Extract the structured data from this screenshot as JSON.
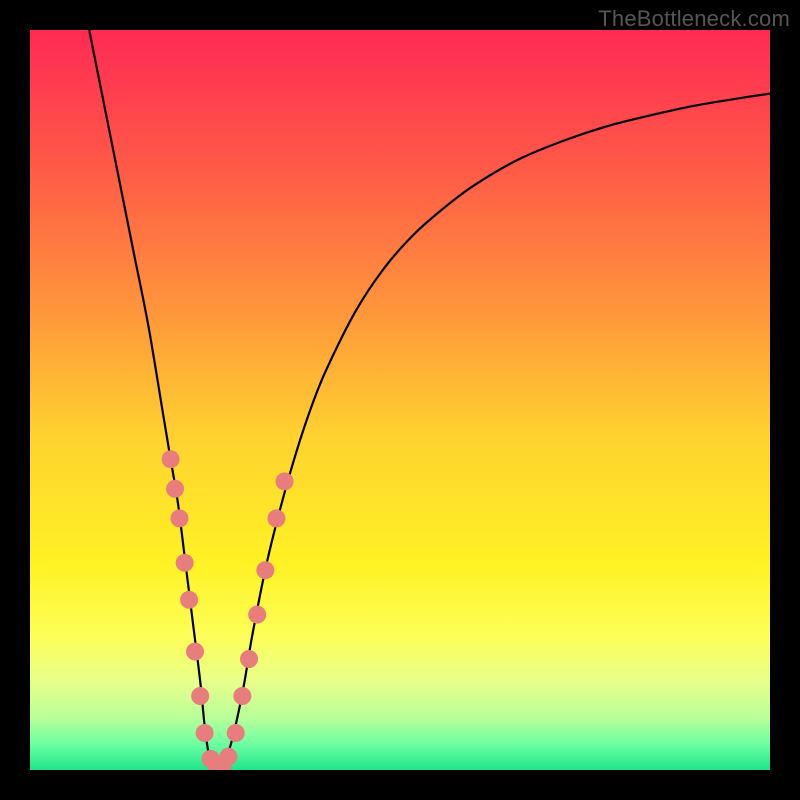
{
  "watermark": "TheBottleneck.com",
  "chart_data": {
    "type": "line",
    "title": "",
    "xlabel": "",
    "ylabel": "",
    "xlim": [
      0,
      100
    ],
    "ylim": [
      0,
      100
    ],
    "legend": false,
    "grid": false,
    "background_gradient_stops": [
      {
        "offset": 0.0,
        "color": "#ff2a55"
      },
      {
        "offset": 0.18,
        "color": "#ff5848"
      },
      {
        "offset": 0.38,
        "color": "#ff963b"
      },
      {
        "offset": 0.55,
        "color": "#ffd22f"
      },
      {
        "offset": 0.72,
        "color": "#fff224"
      },
      {
        "offset": 0.82,
        "color": "#fdff58"
      },
      {
        "offset": 0.88,
        "color": "#e8ff8a"
      },
      {
        "offset": 0.93,
        "color": "#b8ff9a"
      },
      {
        "offset": 0.965,
        "color": "#6dffa2"
      },
      {
        "offset": 1.0,
        "color": "#1fe48b"
      }
    ],
    "series": [
      {
        "name": "bottleneck-curve",
        "color": "#000000",
        "x": [
          8,
          10,
          12,
          14,
          16,
          18,
          19,
          20,
          21,
          22,
          23,
          23.6,
          24.2,
          25,
          26,
          27,
          28,
          29,
          30,
          32,
          34,
          36,
          38,
          40,
          44,
          48,
          52,
          56,
          60,
          66,
          72,
          78,
          84,
          90,
          96,
          100
        ],
        "y": [
          100,
          90,
          80,
          70,
          60,
          48,
          42,
          36,
          28,
          20,
          12,
          6,
          2,
          0.5,
          0.5,
          3,
          7,
          12,
          18,
          28,
          36,
          43,
          49,
          54,
          62,
          68,
          72.5,
          76,
          79,
          82.5,
          85,
          87,
          88.5,
          89.8,
          90.8,
          91.4
        ]
      }
    ],
    "markers": {
      "name": "highlight-points",
      "color": "#e77d7d",
      "radius_px": 9,
      "points": [
        {
          "x": 19.0,
          "y": 42
        },
        {
          "x": 19.6,
          "y": 38
        },
        {
          "x": 20.2,
          "y": 34
        },
        {
          "x": 20.9,
          "y": 28
        },
        {
          "x": 21.5,
          "y": 23
        },
        {
          "x": 22.3,
          "y": 16
        },
        {
          "x": 23.0,
          "y": 10
        },
        {
          "x": 23.6,
          "y": 5
        },
        {
          "x": 24.4,
          "y": 1.5
        },
        {
          "x": 25.2,
          "y": 0.6
        },
        {
          "x": 26.0,
          "y": 0.5
        },
        {
          "x": 26.8,
          "y": 1.8
        },
        {
          "x": 27.8,
          "y": 5
        },
        {
          "x": 28.7,
          "y": 10
        },
        {
          "x": 29.6,
          "y": 15
        },
        {
          "x": 30.7,
          "y": 21
        },
        {
          "x": 31.8,
          "y": 27
        },
        {
          "x": 33.3,
          "y": 34
        },
        {
          "x": 34.4,
          "y": 39
        }
      ]
    }
  }
}
